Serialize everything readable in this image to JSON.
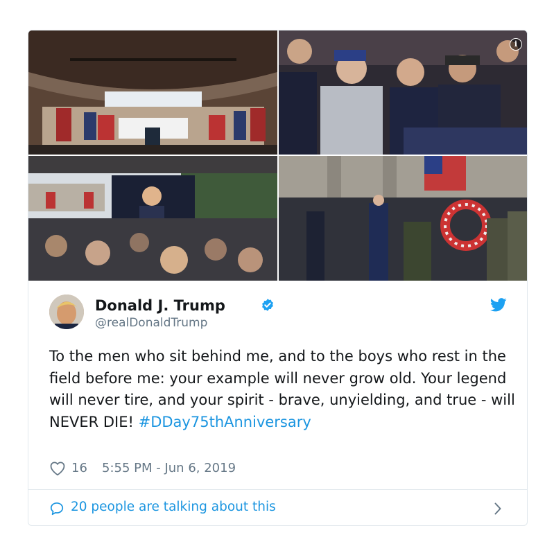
{
  "tweet": {
    "author_name": "Donald J. Trump",
    "author_handle": "@realDonaldTrump",
    "verified": true,
    "text_main": "To the men who sit behind me, and to the boys who rest in the field before me: your example will never grow old. Your legend will never tire, and your spirit - brave, unyielding, and true - will NEVER DIE!",
    "hashtag": "#DDay75thAnniversary",
    "likes": "16",
    "timestamp": "5:55 PM - Jun 6, 2019",
    "talking": "20 people are talking about this"
  },
  "icons": {
    "info": "info-icon",
    "verified": "verified-badge-icon",
    "bird": "twitter-bird-icon",
    "heart": "heart-icon",
    "bubble": "speech-bubble-icon",
    "chevron": "chevron-right-icon"
  },
  "colors": {
    "link": "#1b95e0",
    "secondary_text": "#657786",
    "border": "#e1e8ed"
  }
}
